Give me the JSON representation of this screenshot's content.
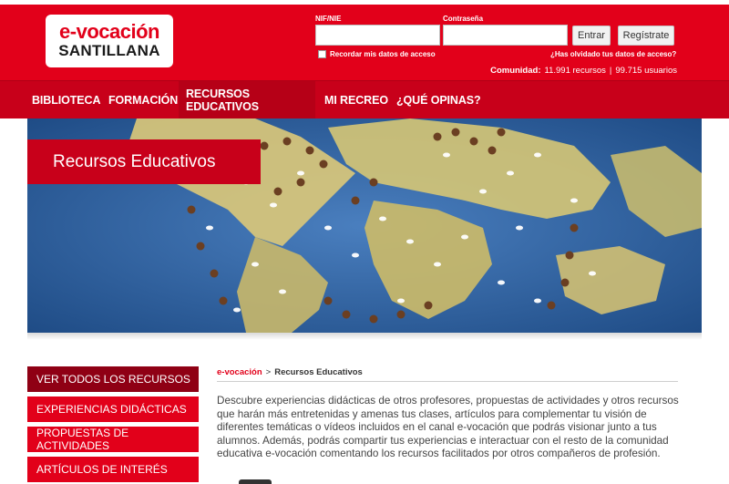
{
  "header": {
    "logo": {
      "line1": "e-vocación",
      "line2": "SANTILLANA"
    },
    "login": {
      "nif_label": "NIF/NIE",
      "nif_value": "",
      "password_label": "Contraseña",
      "password_value": "",
      "enter_button": "Entrar",
      "register_button": "Regístrate",
      "remember_label": "Recordar mis datos de acceso",
      "remember_checked": false,
      "forgot_link": "¿Has olvidado tus datos de acceso?"
    },
    "community": {
      "label": "Comunidad:",
      "resources": "11.991 recursos",
      "separator": "|",
      "users": "99.715 usuarios"
    }
  },
  "nav": {
    "items": [
      {
        "label": "BIBLIOTECA",
        "active": false
      },
      {
        "label": "FORMACIÓN",
        "active": false
      },
      {
        "label": "RECURSOS EDUCATIVOS",
        "active": true
      },
      {
        "label": "MI RECREO",
        "active": false
      },
      {
        "label": "¿QUÉ OPINAS?",
        "active": false
      }
    ]
  },
  "hero": {
    "title": "Recursos Educativos",
    "image": "world-map-with-seeds"
  },
  "sidebar": {
    "items": [
      {
        "label": "VER TODOS LOS RECURSOS",
        "active": true
      },
      {
        "label": "EXPERIENCIAS DIDÁCTICAS",
        "active": false
      },
      {
        "label": "PROPUESTAS DE ACTIVIDADES",
        "active": false
      },
      {
        "label": "ARTÍCULOS DE INTERÉS",
        "active": false
      }
    ]
  },
  "breadcrumb": {
    "home": "e-vocación",
    "separator": ">",
    "current": "Recursos Educativos"
  },
  "content": {
    "description": "Descubre experiencias didácticas de otros profesores, propuestas de actividades y otros recursos que harán más entretenidas y amenas tus clases, artículos para complementar tu visión de diferentes temáticas o vídeos incluidos en el canal e-vocación que podrás visionar junto a tus alumnos. Además, podrás compartir tus experiencias e interactuar con el resto de la comunidad educativa e-vocación comentando los recursos facilitados por otros compañeros de profesión."
  },
  "colors": {
    "brand_red": "#e2001a",
    "nav_red": "#c8001a",
    "active_dark": "#8f0014",
    "ocean": "#2f5f9c",
    "land": "#d9c77a"
  }
}
